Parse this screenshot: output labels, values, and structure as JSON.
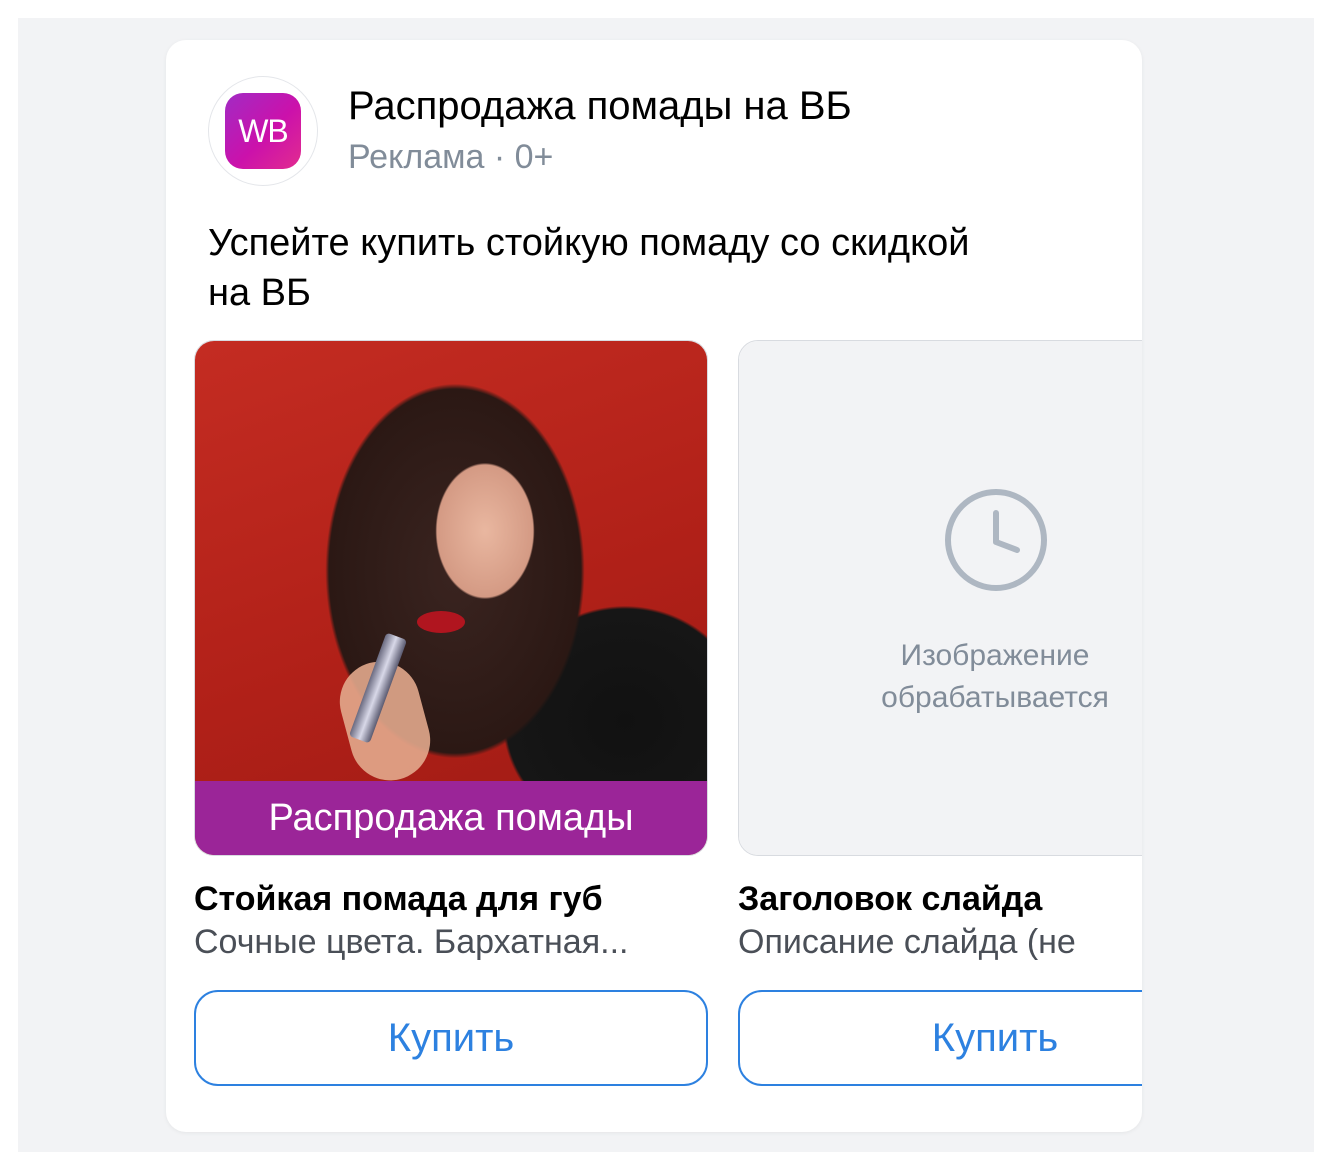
{
  "ad": {
    "logo_text": "WB",
    "title": "Распродажа помады на ВБ",
    "meta": "Реклама · 0+",
    "text": "Успейте купить стойкую помаду со скидкой на ВБ"
  },
  "slides": [
    {
      "banner": "Распродажа помады",
      "title": "Стойкая помада для губ",
      "description": "Сочные цвета. Бархатная...",
      "button": "Купить"
    },
    {
      "processing_line1": "Изображение",
      "processing_line2": "обрабатывается",
      "title": "Заголовок слайда",
      "description": "Описание слайда (не",
      "button": "Купить"
    }
  ],
  "colors": {
    "accent": "#2d81e0",
    "banner": "#9b2598",
    "secondary_text": "#818c99",
    "background": "#f2f3f5"
  },
  "icons": {
    "logo": "wildberries-logo",
    "processing": "clock-icon"
  }
}
